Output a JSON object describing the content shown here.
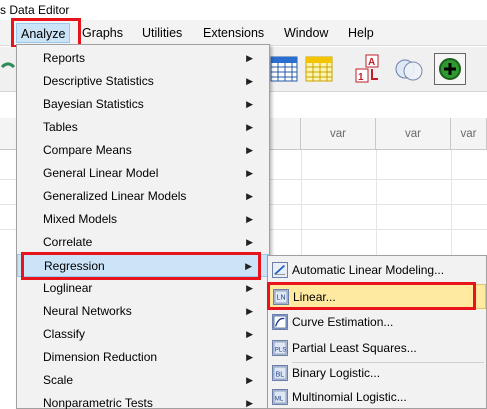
{
  "window": {
    "title": "s Data Editor"
  },
  "menubar": {
    "items": [
      {
        "label": "Analyze"
      },
      {
        "label": "Graphs"
      },
      {
        "label": "Utilities"
      },
      {
        "label": "Extensions"
      },
      {
        "label": "Window"
      },
      {
        "label": "Help"
      }
    ]
  },
  "grid": {
    "columns": [
      "var",
      "var",
      "var"
    ]
  },
  "analyze_menu": {
    "items": [
      {
        "label": "Reports"
      },
      {
        "label": "Descriptive Statistics"
      },
      {
        "label": "Bayesian Statistics"
      },
      {
        "label": "Tables"
      },
      {
        "label": "Compare Means"
      },
      {
        "label": "General Linear Model"
      },
      {
        "label": "Generalized Linear Models"
      },
      {
        "label": "Mixed Models"
      },
      {
        "label": "Correlate"
      },
      {
        "label": "Regression"
      },
      {
        "label": "Loglinear"
      },
      {
        "label": "Neural Networks"
      },
      {
        "label": "Classify"
      },
      {
        "label": "Dimension Reduction"
      },
      {
        "label": "Scale"
      },
      {
        "label": "Nonparametric Tests"
      }
    ]
  },
  "regression_submenu": {
    "items": [
      {
        "label": "Automatic Linear Modeling...",
        "icon": "auto-linear-icon"
      },
      {
        "label": "Linear...",
        "icon": "linear-regression-icon"
      },
      {
        "label": "Curve Estimation...",
        "icon": "curve-estimation-icon"
      },
      {
        "label": "Partial Least Squares...",
        "icon": "partial-least-squares-icon"
      },
      {
        "label": "Binary Logistic...",
        "icon": "binary-logistic-icon"
      },
      {
        "label": "Multinomial Logistic...",
        "icon": "multinomial-logistic-icon"
      }
    ]
  },
  "colors": {
    "highlight_red": "#e8141c",
    "menu_hover": "#cce4f7",
    "submenu_hover": "#ffeaa0"
  }
}
